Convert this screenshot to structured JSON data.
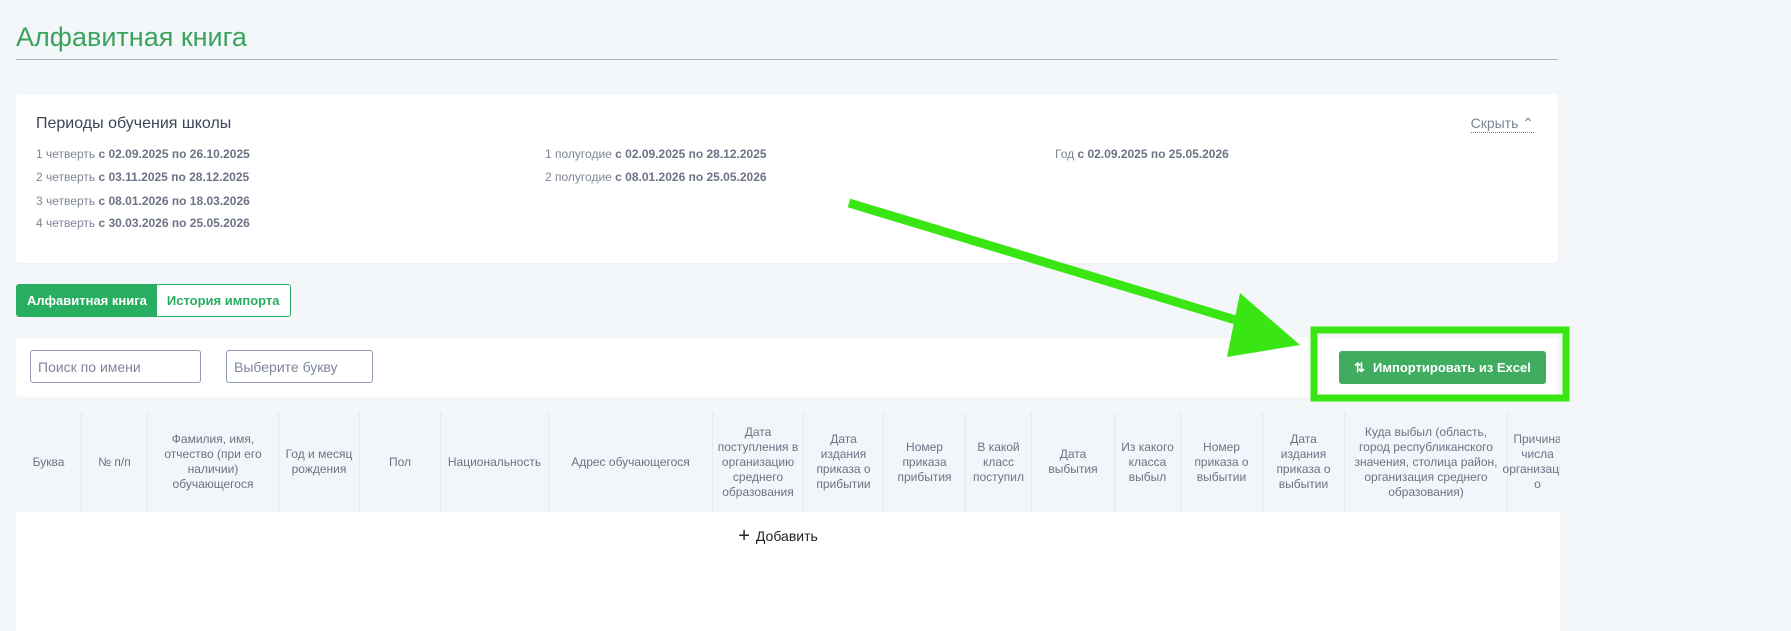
{
  "page": {
    "title": "Алфавитная книга"
  },
  "periods": {
    "heading": "Периоды обучения школы",
    "hide_label": "Скрыть",
    "quarters": [
      {
        "label": "1 четверть",
        "range": "с 02.09.2025 по 26.10.2025"
      },
      {
        "label": "2 четверть",
        "range": "с 03.11.2025 по 28.12.2025"
      },
      {
        "label": "3 четверть",
        "range": "с 08.01.2026 по 18.03.2026"
      },
      {
        "label": "4 четверть",
        "range": "с 30.03.2026 по 25.05.2026"
      }
    ],
    "halves": [
      {
        "label": "1 полугодие",
        "range": "с 02.09.2025 по 28.12.2025"
      },
      {
        "label": "2 полугодие",
        "range": "с 08.01.2026 по 25.05.2026"
      }
    ],
    "year": {
      "label": "Год",
      "range": "с 02.09.2025 по 25.05.2026"
    }
  },
  "tabs": [
    {
      "label": "Алфавитная книга",
      "active": true
    },
    {
      "label": "История импорта",
      "active": false
    }
  ],
  "filters": {
    "search_placeholder": "Поиск по имени",
    "letter_placeholder": "Выберите букву"
  },
  "import_button": {
    "label": "Импортировать из Excel"
  },
  "table": {
    "columns": [
      "Буква",
      "№ п/п",
      "Фамилия, имя, отчество (при его наличии) обучающегося",
      "Год и месяц рождения",
      "Пол",
      "Национальность",
      "Адрес обучающегося",
      "Дата поступления в организацию среднего образования",
      "Дата издания приказа о прибытии",
      "Номер приказа прибытия",
      "В какой класс поступил",
      "Дата выбытия",
      "Из какого класса выбыл",
      "Номер приказа о выбытии",
      "Дата издания приказа о выбытии",
      "Куда выбыл (область, город республиканского значения, столица район, организация среднего образования)",
      "Причина числа организации о"
    ],
    "add_label": "Добавить"
  },
  "colors": {
    "accent": "#27ae60",
    "annotation": "#39e614"
  }
}
